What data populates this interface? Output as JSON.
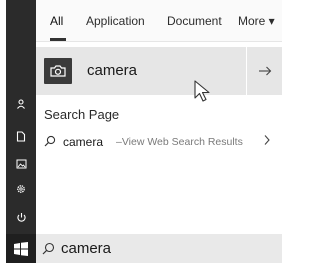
{
  "tabs": {
    "all": "All",
    "application": "Application",
    "document": "Document",
    "more": "More ▾"
  },
  "top_result": {
    "label": "camera",
    "icon": "camera-icon",
    "open_icon": "arrow-right-icon"
  },
  "search_page": {
    "title": "Search Page",
    "query": "camera",
    "description": "–View Web Search Results"
  },
  "searchbar": {
    "query": "camera"
  },
  "rail_icons": [
    "user-icon",
    "document-icon",
    "pictures-icon",
    "settings-icon",
    "power-icon",
    "windows-start-icon"
  ],
  "colors": {
    "rail": "#2b2b2b",
    "highlight": "#e6e6e6",
    "searchbar": "#e9e9e9"
  }
}
